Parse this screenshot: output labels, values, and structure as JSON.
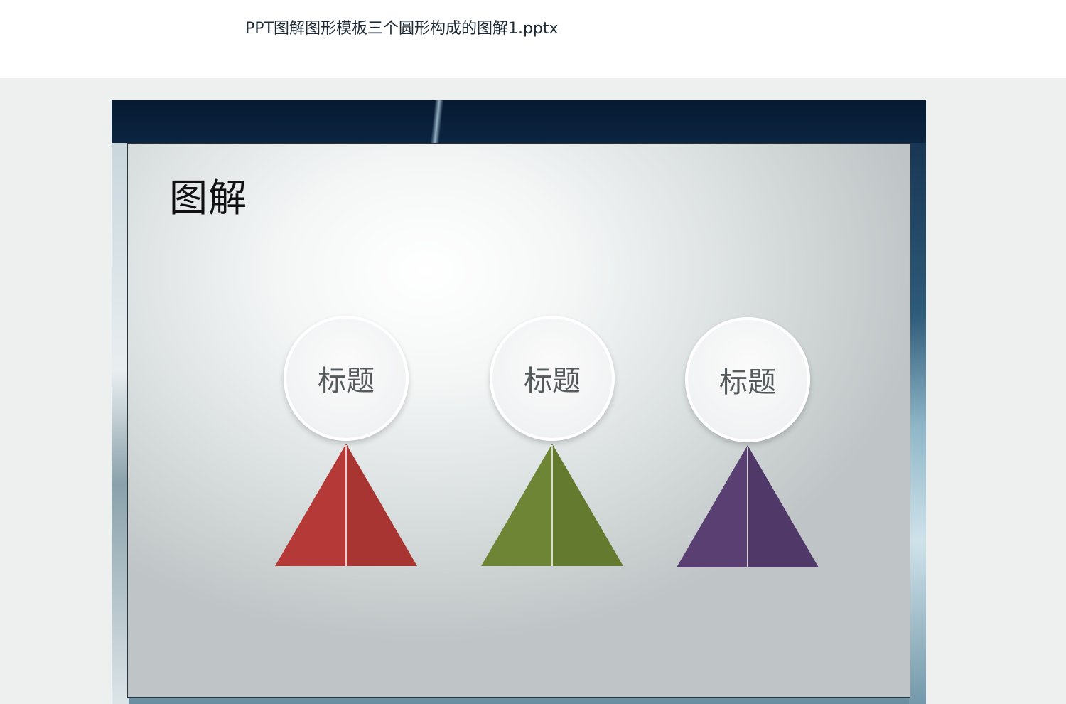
{
  "header": {
    "file_title": "PPT图解图形模板三个圆形构成的图解1.pptx"
  },
  "slide": {
    "title": "图解",
    "nodes": [
      {
        "label": "标题",
        "color_left": "#b53a37",
        "color_right": "#a93532"
      },
      {
        "label": "标题",
        "color_left": "#6e8535",
        "color_right": "#637a2f"
      },
      {
        "label": "标题",
        "color_left": "#5a3f72",
        "color_right": "#503868"
      }
    ]
  }
}
